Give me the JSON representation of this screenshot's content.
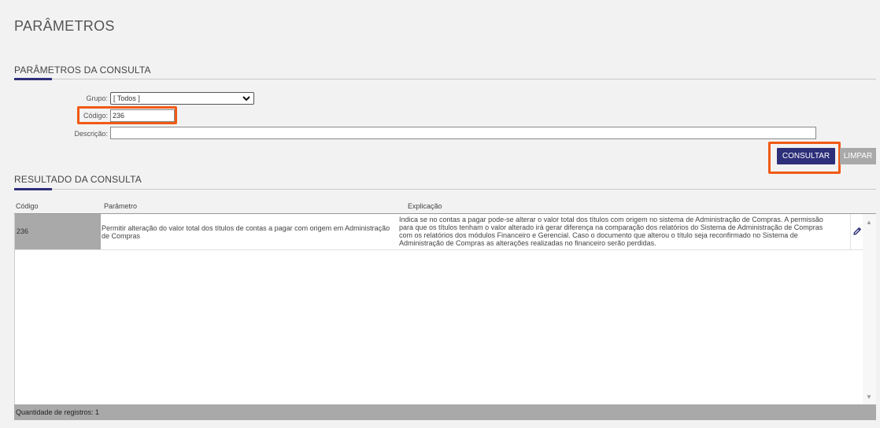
{
  "page": {
    "title": "PARÂMETROS"
  },
  "filter": {
    "section_title": "PARÂMETROS DA CONSULTA",
    "grupo_label": "Grupo:",
    "grupo_value": "[ Todos ]",
    "codigo_label": "Código:",
    "codigo_value": "236",
    "descricao_label": "Descrição:",
    "descricao_value": "",
    "consultar_label": "CONSULTAR",
    "limpar_label": "LIMPAR"
  },
  "results": {
    "section_title": "RESULTADO DA CONSULTA",
    "columns": [
      "Código",
      "Parâmetro",
      "Explicação"
    ],
    "rows": [
      {
        "codigo": "236",
        "parametro": "Permitir alteração do valor total dos títulos de contas a pagar com origem em Administração de Compras",
        "explicacao": "Indica se no contas a pagar pode-se alterar o valor total dos títulos com origem no sistema de Administração de Compras. A permissão para que os títulos tenham o valor alterado irá gerar diferença na comparação dos relatórios do Sistema de Administração de Compras com os relatórios dos módulos Financeiro e Gerencial. Caso o documento que alterou o título seja reconfirmado no Sistema de Administração de Compras as alterações realizadas no financeiro serão perdidas."
      }
    ],
    "footer": "Quantidade de registros: 1"
  },
  "icons": {
    "edit": "pencil-icon",
    "dropdown": "chevron-down-icon"
  },
  "colors": {
    "primary": "#2d2f7a",
    "highlight": "#f05a14",
    "secondary": "#a9a9a9"
  }
}
